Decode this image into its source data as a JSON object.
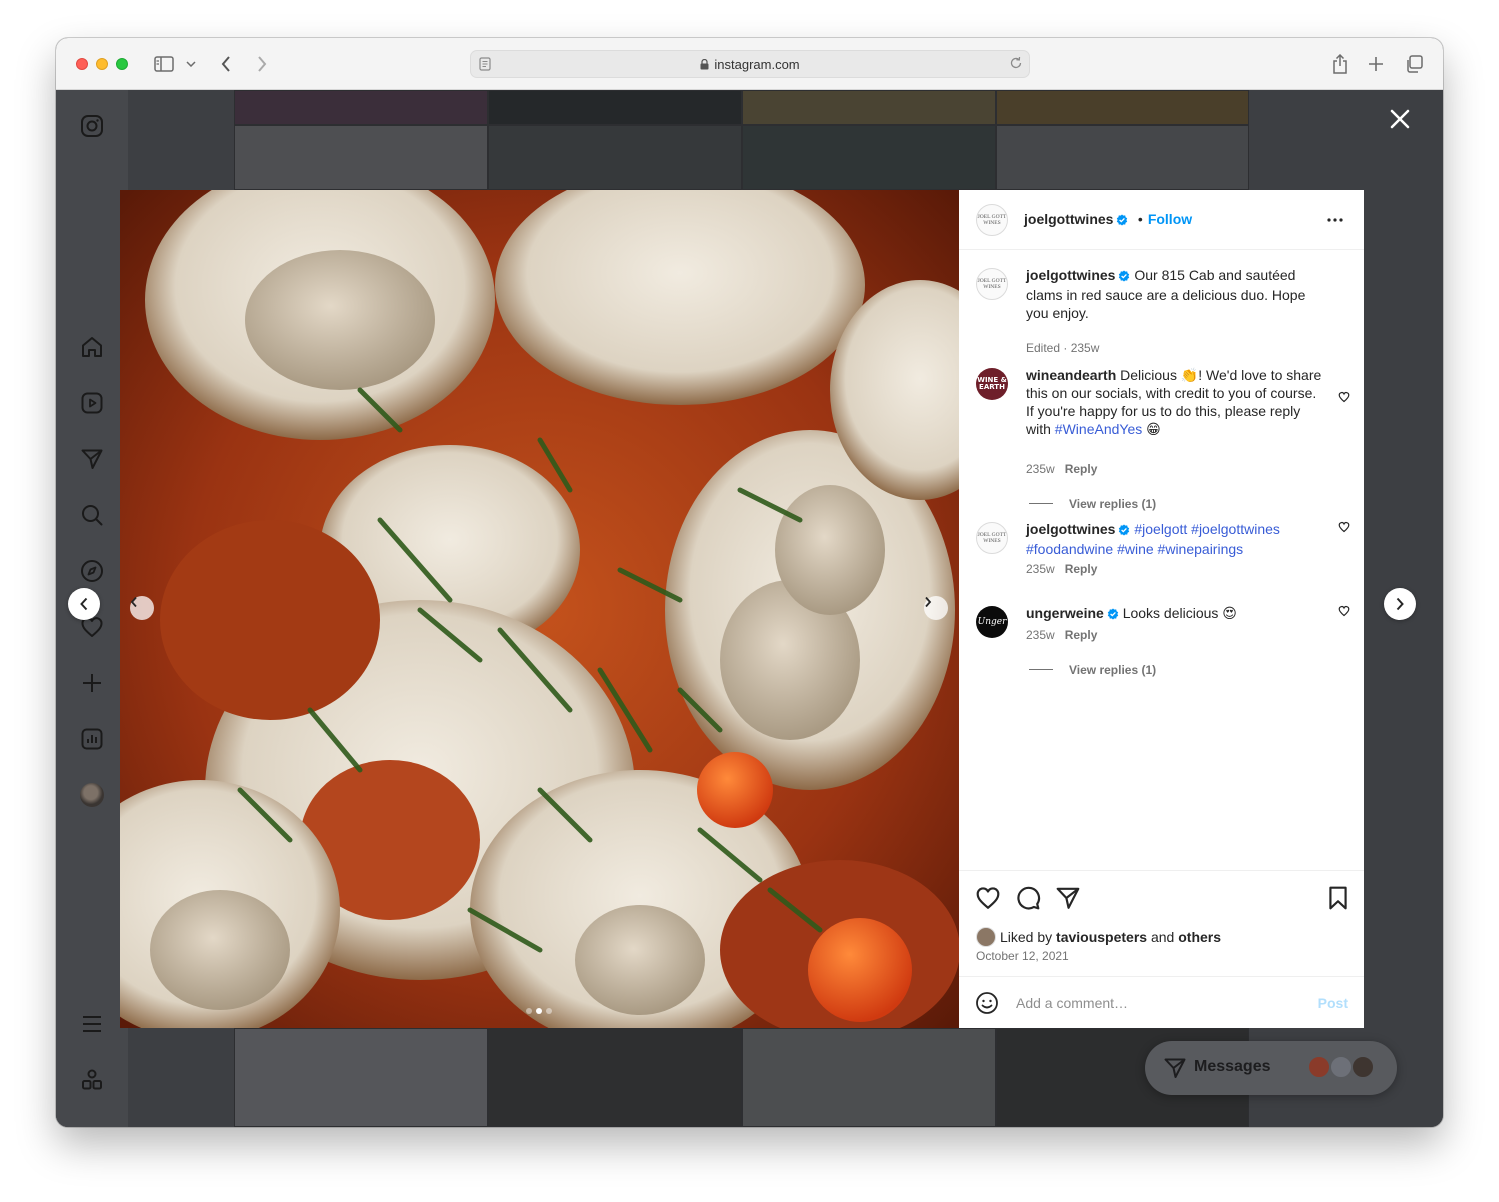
{
  "browser": {
    "url": "instagram.com"
  },
  "post": {
    "author": "joelgottwines",
    "follow_label": "Follow",
    "avatar_text": "JOEL GOTT WINES",
    "caption": {
      "username": "joelgottwines",
      "text": "Our 815 Cab and sautéed clams in red sauce are a delicious duo. Hope you enjoy.",
      "meta": "Edited · 235w"
    },
    "comments": [
      {
        "username": "wineandearth",
        "avatar_text": "WINE & EARTH",
        "text": "Delicious 👏! We'd love to share this on our socials, with credit to you of course. If you're happy for us to do this, please reply with",
        "hashtag": "#WineAndYes",
        "trail": "😁",
        "age": "235w",
        "reply_label": "Reply",
        "view_replies": "View replies (1)"
      },
      {
        "username": "joelgottwines",
        "text_line1": "#joelgott #joelgottwines",
        "text_line2": "#foodandwine #wine #winepairings",
        "age": "235w",
        "reply_label": "Reply"
      },
      {
        "username": "ungerweine",
        "avatar_text": "Unger",
        "text": "Looks delicious 😍",
        "age": "235w",
        "reply_label": "Reply",
        "view_replies": "View replies (1)"
      }
    ],
    "liked_by_prefix": "Liked by",
    "liked_by_user": "taviouspeters",
    "liked_by_and": "and",
    "liked_by_others": "others",
    "date": "October 12, 2021",
    "comment_placeholder": "Add a comment…",
    "post_label": "Post",
    "carousel": {
      "slides": 3,
      "active": 2
    }
  },
  "messages": {
    "label": "Messages"
  },
  "colors": {
    "link_blue": "#0095f6",
    "hashtag_blue": "#385cd6",
    "modal_backdrop": "#3d3f43"
  }
}
